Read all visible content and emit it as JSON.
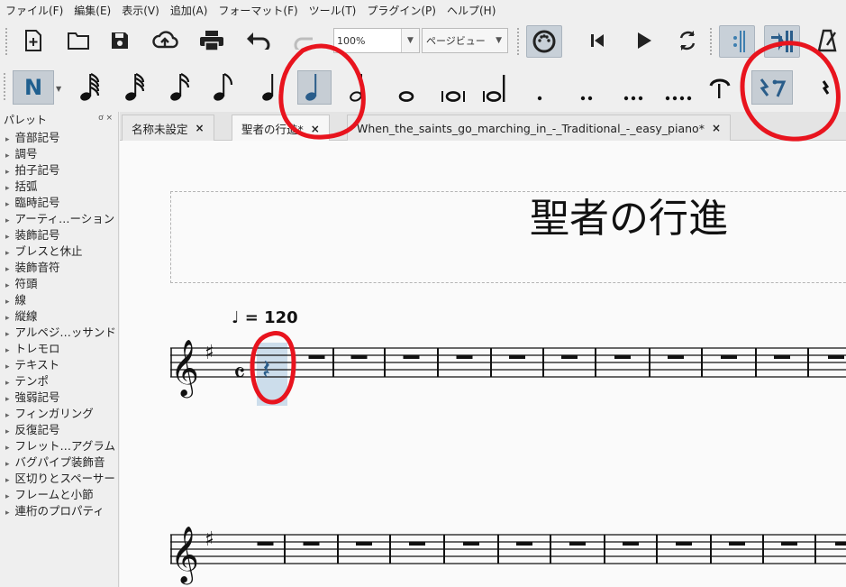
{
  "menubar": {
    "items": [
      "ファイル(F)",
      "編集(E)",
      "表示(V)",
      "追加(A)",
      "フォーマット(F)",
      "ツール(T)",
      "プラグイン(P)",
      "ヘルプ(H)"
    ]
  },
  "toolbar": {
    "icons": [
      "new-file-icon",
      "open-folder-icon",
      "save-icon",
      "cloud-upload-icon",
      "print-icon",
      "undo-icon",
      "redo-icon",
      "midi-icon",
      "rewind-icon",
      "play-icon",
      "loop-icon",
      "play-repeats-icon",
      "pan-icon",
      "metronome-icon"
    ],
    "zoom_value": "100%",
    "view_mode": "ページビュー"
  },
  "note_input": {
    "mode_label": "N",
    "durations": [
      "64th",
      "32nd",
      "16th",
      "eighth",
      "quarter",
      "half",
      "whole",
      "breve",
      "longa",
      "augmentation-dot",
      "double-dot",
      "triple-dot",
      "quadruple-dot",
      "tie",
      "rest"
    ],
    "selected_duration": "quarter"
  },
  "palette": {
    "title": "パレット",
    "controls": "ơ ×",
    "items": [
      "音部記号",
      "調号",
      "拍子記号",
      "括弧",
      "臨時記号",
      "アーティ…ーション",
      "装飾記号",
      "ブレスと休止",
      "装飾音符",
      "符頭",
      "線",
      "縦線",
      "アルペジ…ッサンド",
      "トレモロ",
      "テキスト",
      "テンポ",
      "強弱記号",
      "フィンガリング",
      "反復記号",
      "フレット…アグラム",
      "バグパイプ装飾音",
      "区切りとスペーサー",
      "フレームと小節",
      "連桁のプロパティ"
    ]
  },
  "tabs": [
    {
      "label": "名称未設定",
      "close": "×"
    },
    {
      "label": "聖者の行進*",
      "close": "×"
    },
    {
      "label": "When_the_saints_go_marching_in_-_Traditional_-_easy_piano*",
      "close": "×"
    }
  ],
  "score": {
    "title": "聖者の行進",
    "tempo_text": "♩ = 120"
  },
  "colors": {
    "annotation": "#e8141e",
    "selection": "#9bbdda",
    "accent": "#2a5d8a"
  }
}
